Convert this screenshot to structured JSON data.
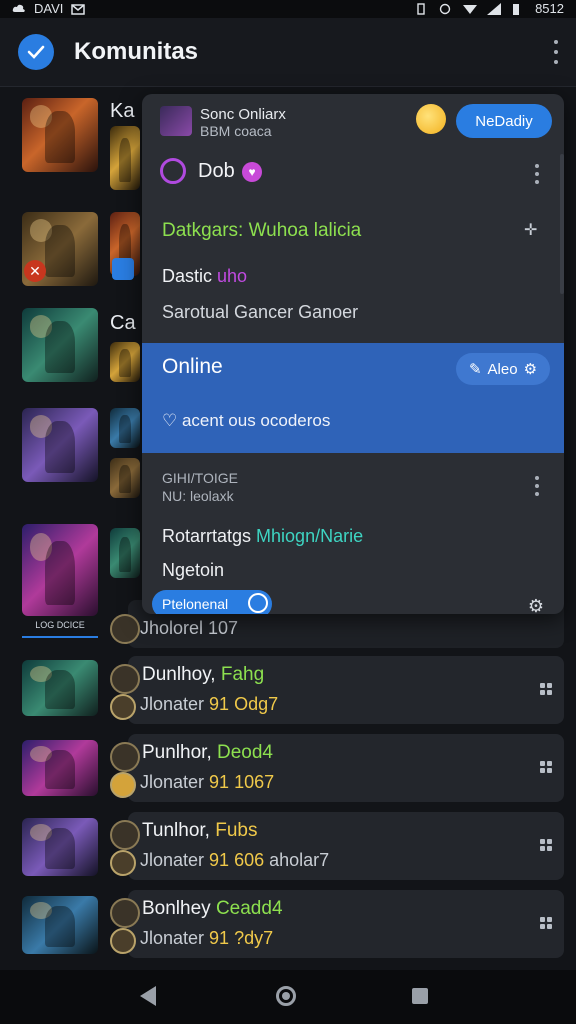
{
  "status_bar": {
    "carrier": "DAVI",
    "time": "8512"
  },
  "app_bar": {
    "title": "Komunitas"
  },
  "left_column": {
    "row_fragments": [
      "Ka",
      "Ca"
    ],
    "thumb_caption": "LOG DCICE"
  },
  "popup": {
    "header_title": "Sonc Onliarx",
    "header_sub": "BBM coaca",
    "action_button": "NeDadiy",
    "user_name": "Dob",
    "green_line": "Datkgars: Wuhoa lalicia",
    "name_line_prefix": "Dastic ",
    "name_line_accent": "uho",
    "description": "Sarotual Gancer Ganoer",
    "online_label": "Online",
    "band_button": "Aleo",
    "band_line": "acent ous ocoderos",
    "section_label_1": "GIHI/TOIGE",
    "section_label_2": "NU: leolaxk",
    "roles_prefix": "Rotarrtatgs ",
    "roles_accent": "Mhiogn/Narie",
    "status_line": "Ngetoin",
    "pill_label": "Ptelonenal"
  },
  "partial_card": {
    "subtitle": "Jholorel 107"
  },
  "cards": [
    {
      "title": "Dunlhoy, ",
      "title_accent": "Fahg",
      "sub_prefix": "Jlonater ",
      "sub_accent": "91 Odg7"
    },
    {
      "title": "Punlhor, ",
      "title_accent": "Deod4",
      "sub_prefix": "Jlonater ",
      "sub_accent": "91 1067"
    },
    {
      "title": "Tunlhor, ",
      "title_accent": "Fubs",
      "sub_prefix": "Jlonater ",
      "sub_accent": "91 606",
      "sub_tail": " aholar7"
    },
    {
      "title": "Bonlhey ",
      "title_accent": "Ceadd4",
      "sub_prefix": "Jlonater ",
      "sub_accent": "91 ?dy7"
    }
  ],
  "colors": {
    "accent_blue": "#2a7de1",
    "green": "#8de04f",
    "gold": "#f0c94a",
    "purple": "#b04adf"
  }
}
